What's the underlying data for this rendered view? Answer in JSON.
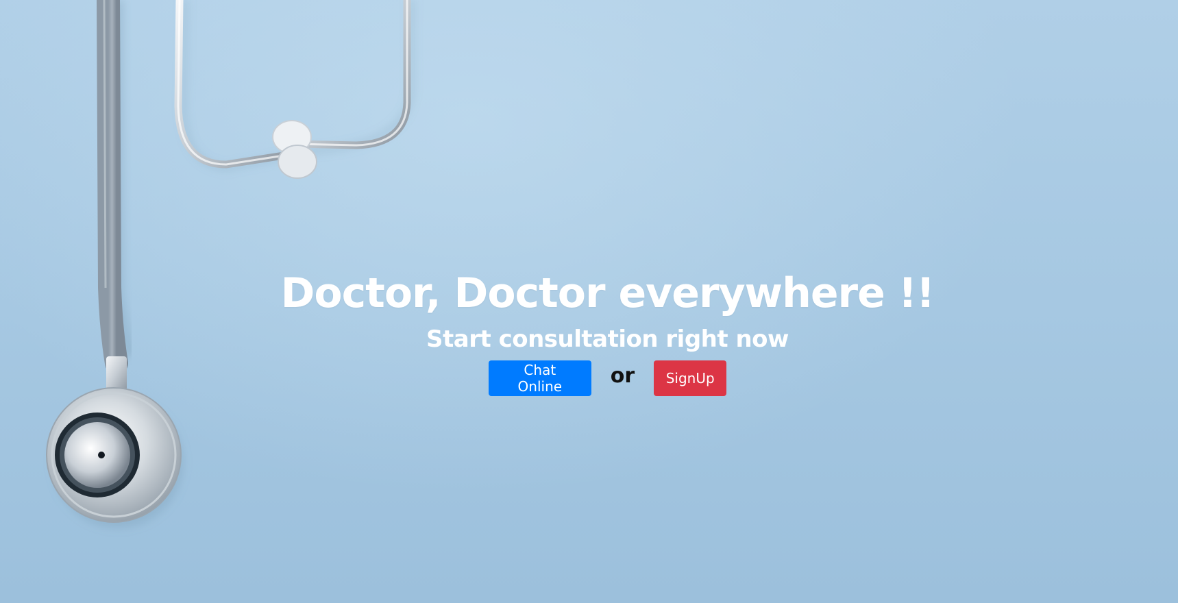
{
  "hero": {
    "headline": "Doctor, Doctor everywhere !!",
    "subheadline": "Start consultation right now",
    "buttons": {
      "chat_label": "Chat Online",
      "or_text": "or",
      "signup_label": "SignUp"
    }
  },
  "colors": {
    "background": "#a6c8e2",
    "chat_button": "#007bff",
    "signup_button": "#dc3545",
    "headline_text": "#ffffff"
  },
  "icons": [
    "stethoscope-image"
  ]
}
